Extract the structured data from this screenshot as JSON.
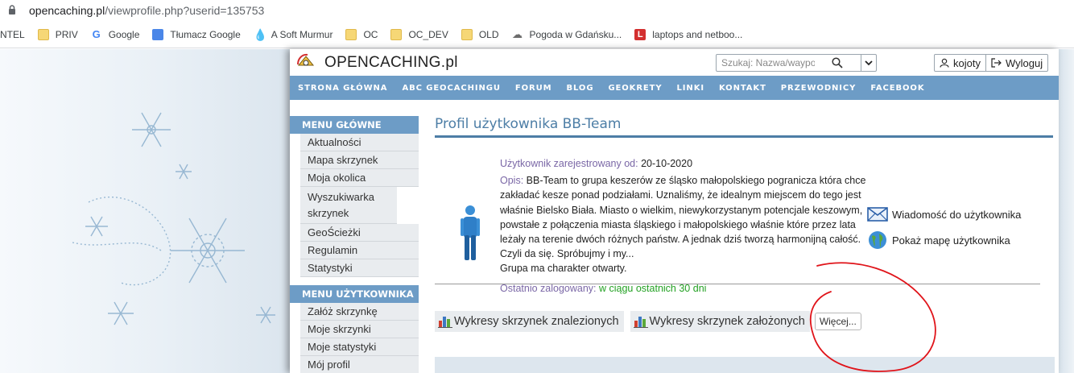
{
  "browser": {
    "url_host": "opencaching.pl",
    "url_path": "/viewprofile.php?userid=135753",
    "bookmarks": [
      {
        "label": "NTEL",
        "icon": "none"
      },
      {
        "label": "PRIV",
        "icon": "folder-icon"
      },
      {
        "label": "Google",
        "icon": "google-icon"
      },
      {
        "label": "Tłumacz Google",
        "icon": "translate-icon"
      },
      {
        "label": "A Soft Murmur",
        "icon": "drop-icon"
      },
      {
        "label": "OC",
        "icon": "folder-icon"
      },
      {
        "label": "OC_DEV",
        "icon": "folder-icon"
      },
      {
        "label": "OLD",
        "icon": "folder-icon"
      },
      {
        "label": "Pogoda w Gdańsku...",
        "icon": "cloud-icon"
      },
      {
        "label": "laptops and netboo...",
        "icon": "l-icon"
      }
    ]
  },
  "site": {
    "logo_text": "OPENCACHING.pl",
    "search_placeholder": "Szukaj: Nazwa/waypoint",
    "user_button": "kojoty",
    "logout_button": "Wyloguj",
    "nav": [
      "STRONA GŁÓWNA",
      "ABC GEOCACHINGU",
      "FORUM",
      "BLOG",
      "GEOKRETY",
      "LINKI",
      "KONTAKT",
      "PRZEWODNICY",
      "FACEBOOK"
    ]
  },
  "sidebar": {
    "main_menu_title": "MENU GŁÓWNE",
    "main_menu": [
      "Aktualności",
      "Mapa skrzynek",
      "Moja okolica",
      "Wyszukiwarka skrzynek",
      "GeoŚcieżki",
      "Regulamin",
      "Statystyki"
    ],
    "user_menu_title": "MENU UŻYTKOWNIKA",
    "user_menu": [
      "Załóż skrzynkę",
      "Moje skrzynki",
      "Moje statystyki",
      "Mój profil"
    ]
  },
  "profile": {
    "title": "Profil użytkownika BB-Team",
    "registered_label": "Użytkownik zarejestrowany od:",
    "registered_value": "20-10-2020",
    "description_label": "Opis:",
    "description": "BB-Team to grupa keszerów ze śląsko małopolskiego pogranicza która chce zakładać kesze ponad podziałami. Uznaliśmy, że idealnym miejscem do tego jest właśnie Bielsko Biała. Miasto o wielkim, niewykorzystanym potencjale keszowym, powstałe z połączenia miasta śląskiego i małopolskiego właśnie które przez lata leżały na terenie dwóch różnych państw. A jednak dziś tworzą harmonijną całość. Czyli da się. Spróbujmy i my...",
    "description_extra": "Grupa ma charakter otwarty.",
    "last_login_label": "Ostatnio zalogowany:",
    "last_login_value": "w ciągu ostatnich 30 dni",
    "actions": [
      "Wiadomość do użytkownika",
      "Pokaż mapę użytkownika"
    ],
    "tabs": [
      "Wykresy skrzynek znalezionych",
      "Wykresy skrzynek założonych"
    ],
    "more_button": "Więcej..."
  },
  "colors": {
    "nav_bg": "#6d9cc6",
    "title": "#4d7ea6",
    "label_purple": "#7a67a6",
    "green": "#23a123",
    "annotation_red": "#e0141a"
  }
}
